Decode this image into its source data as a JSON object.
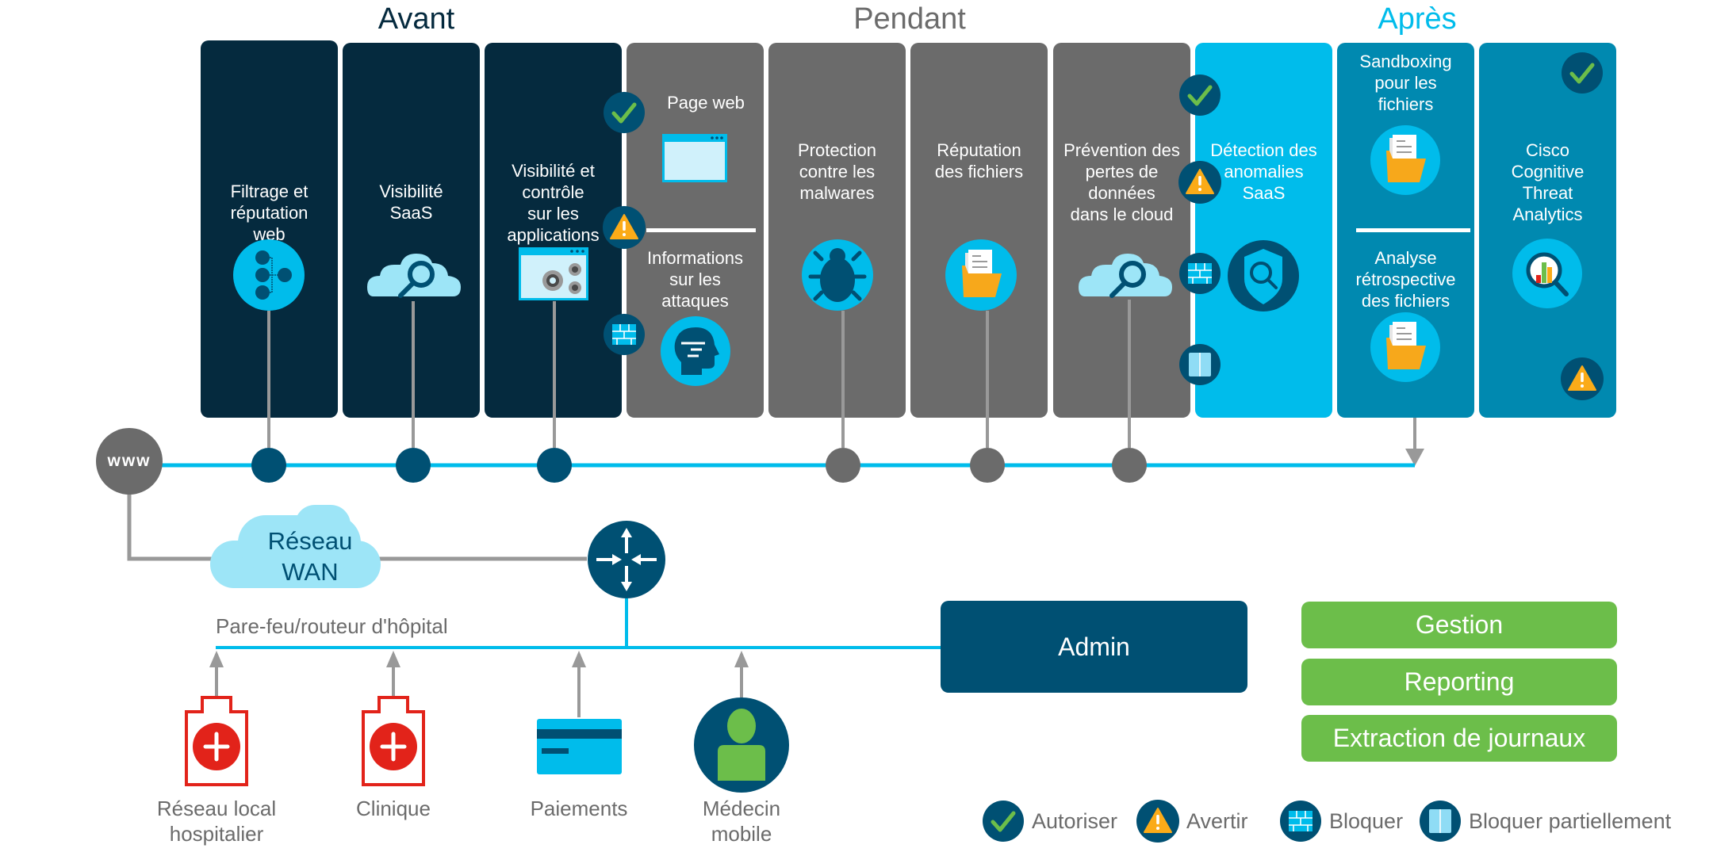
{
  "phases": {
    "before": {
      "label": "Avant",
      "color": "#052a3e"
    },
    "during": {
      "label": "Pendant",
      "color": "#6b6b6b"
    },
    "after": {
      "label": "Après",
      "color": "#00bceb"
    }
  },
  "panels": [
    {
      "id": "web-filtering",
      "title": "Filtrage et\nréputation\nweb",
      "phase": "before",
      "icon": "network-nodes-icon",
      "status_icons": []
    },
    {
      "id": "saas-visibility",
      "title": "Visibilité\nSaaS",
      "phase": "before",
      "icon": "cloud-search-icon",
      "status_icons": []
    },
    {
      "id": "app-visibility",
      "title": "Visibilité et\ncontrôle\nsur les\napplications",
      "phase": "before",
      "icon": "app-settings-icon",
      "status_icons": [
        "allow",
        "warn",
        "block"
      ]
    },
    {
      "id": "web-page-threat-intel",
      "phase": "during",
      "sections": [
        {
          "title": "Page web",
          "icon": "browser-window-icon"
        },
        {
          "title": "Informations\nsur les\nattaques",
          "icon": "brain-head-icon"
        }
      ]
    },
    {
      "id": "malware-protection",
      "title": "Protection\ncontre les\nmalwares",
      "phase": "during",
      "icon": "bug-icon",
      "status_icons": []
    },
    {
      "id": "file-reputation",
      "title": "Réputation\ndes fichiers",
      "phase": "during",
      "icon": "file-folder-icon",
      "status_icons": []
    },
    {
      "id": "cloud-dlp",
      "title": "Prévention des\npertes de\ndonnées\ndans le cloud",
      "phase": "during",
      "icon": "cloud-search-icon",
      "status_icons": [
        "allow",
        "warn",
        "block",
        "partial-block"
      ]
    },
    {
      "id": "saas-anomaly",
      "title": "Détection des\nanomalies\nSaaS",
      "phase": "after",
      "icon": "shield-search-icon",
      "status_icons": []
    },
    {
      "id": "file-sandboxing",
      "phase": "after",
      "sections": [
        {
          "title": "Sandboxing\npour les\nfichiers",
          "icon": "file-folder-icon"
        },
        {
          "title": "Analyse\nrétrospective\ndes fichiers",
          "icon": "file-folder-icon"
        }
      ]
    },
    {
      "id": "cognitive-threat",
      "title": "Cisco\nCognitive\nThreat\nAnalytics",
      "phase": "after",
      "icon": "analytics-search-icon",
      "status_icons": [
        "allow",
        "warn"
      ]
    }
  ],
  "network": {
    "internet_label": "www",
    "wan_label": "Réseau\nWAN",
    "router_label": "Pare-feu/routeur d'hôpital",
    "endpoints": [
      {
        "label": "Réseau local\nhospitalier",
        "icon": "hospital-icon"
      },
      {
        "label": "Clinique",
        "icon": "hospital-icon"
      },
      {
        "label": "Paiements",
        "icon": "credit-card-icon"
      },
      {
        "label": "Médecin\nmobile",
        "icon": "user-icon"
      }
    ]
  },
  "admin": {
    "label": "Admin",
    "actions": [
      "Gestion",
      "Reporting",
      "Extraction de journaux"
    ]
  },
  "legend": [
    {
      "key": "allow",
      "label": "Autoriser"
    },
    {
      "key": "warn",
      "label": "Avertir"
    },
    {
      "key": "block",
      "label": "Bloquer"
    },
    {
      "key": "partial-block",
      "label": "Bloquer partiellement"
    }
  ],
  "colors": {
    "before_panel": "#052a3e",
    "during_panel": "#6b6b6b",
    "after_panel_light": "#00bceb",
    "after_panel_dark": "#0089b0",
    "accent_blue": "#00bceb",
    "dark_blue": "#005073",
    "green": "#6cbe4a",
    "warning": "#fbab18",
    "red": "#e2231a"
  }
}
